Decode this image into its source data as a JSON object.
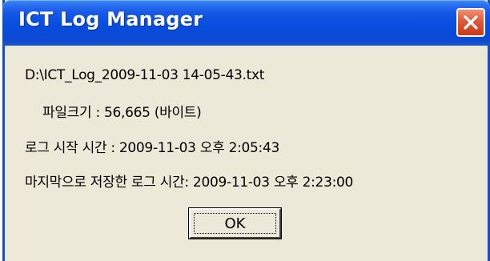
{
  "window": {
    "title": "ICT Log Manager",
    "close_icon": "close-x-icon"
  },
  "info": {
    "file_path": "D:\\ICT_Log_2009-11-03 14-05-43.txt",
    "file_size": "파일크기 : 56,665 (바이트)",
    "log_start": "로그 시작 시간 : 2009-11-03 오후 2:05:43",
    "log_last_saved": "마지막으로 저장한 로그 시간: 2009-11-03 오후 2:23:00"
  },
  "buttons": {
    "ok_label": "OK"
  },
  "colors": {
    "titlebar": "#0a4fe0",
    "close_button": "#e05a3a",
    "dialog_bg": "#ece9d8"
  }
}
